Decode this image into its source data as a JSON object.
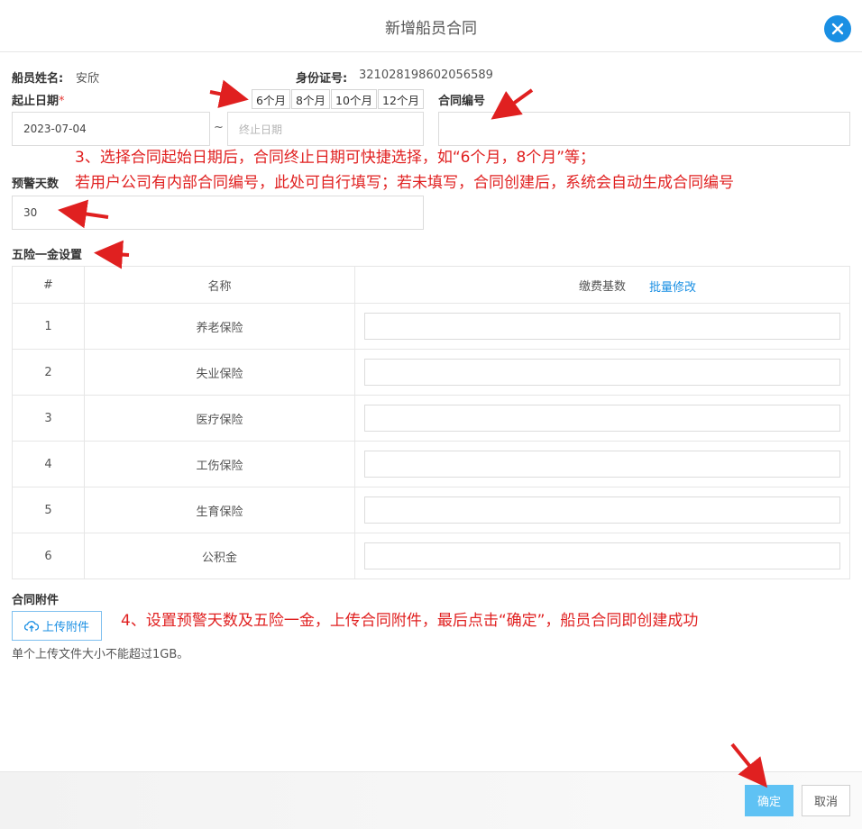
{
  "dialog": {
    "title": "新增船员合同"
  },
  "crew": {
    "name_label": "船员姓名:",
    "name_value": "安欣",
    "id_label": "身份证号:",
    "id_value": "321028198602056589"
  },
  "dates": {
    "label": "起止日期",
    "required_mark": "*",
    "start_value": "2023-07-04",
    "separator": "~",
    "end_placeholder": "终止日期",
    "quick_options": [
      "6个月",
      "8个月",
      "10个月",
      "12个月"
    ]
  },
  "contract_no": {
    "label": "合同编号",
    "value": ""
  },
  "warning": {
    "label": "预警天数",
    "value": "30"
  },
  "insurance": {
    "section_label": "五险一金设置",
    "headers": {
      "index": "#",
      "name": "名称",
      "base": "缴费基数"
    },
    "batch_edit": "批量修改",
    "rows": [
      {
        "index": "1",
        "name": "养老保险"
      },
      {
        "index": "2",
        "name": "失业保险"
      },
      {
        "index": "3",
        "name": "医疗保险"
      },
      {
        "index": "4",
        "name": "工伤保险"
      },
      {
        "index": "5",
        "name": "生育保险"
      },
      {
        "index": "6",
        "name": "公积金"
      }
    ]
  },
  "attachment": {
    "label": "合同附件",
    "upload_button": "上传附件",
    "hint": "单个上传文件大小不能超过1GB。"
  },
  "annotations": {
    "step3_line1": "3、选择合同起始日期后，合同终止日期可快捷选择，如“6个月，8个月”等；",
    "step3_line2": "若用户公司有内部合同编号，此处可自行填写；若未填写，合同创建后，系统会自动生成合同编号",
    "step4": "4、设置预警天数及五险一金，上传合同附件，最后点击“确定”，船员合同即创建成功"
  },
  "footer": {
    "ok": "确定",
    "cancel": "取消"
  },
  "colors": {
    "accent": "#1a8fe3",
    "ok_button": "#5fc2f4",
    "annotation": "#e02020"
  }
}
